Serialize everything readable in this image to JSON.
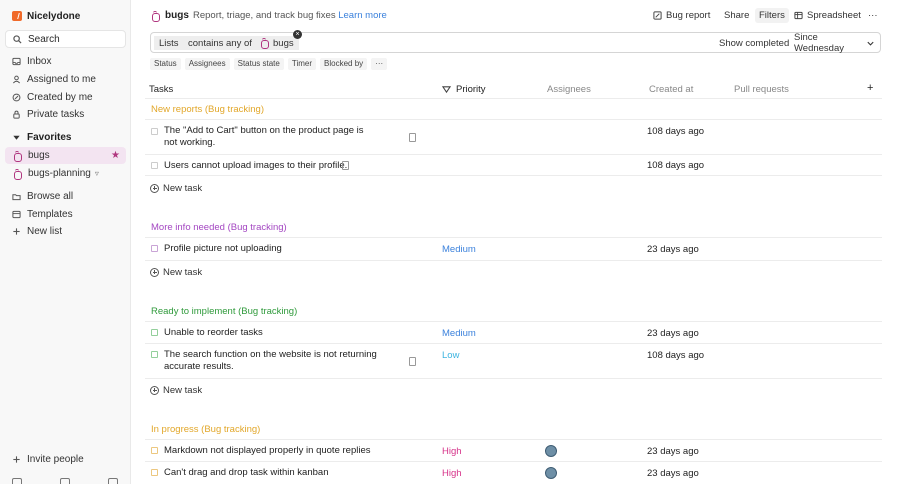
{
  "workspace": {
    "name": "Nicelydone"
  },
  "sidebar": {
    "search_label": "Search",
    "items": [
      {
        "label": "Inbox"
      },
      {
        "label": "Assigned to me"
      },
      {
        "label": "Created by me"
      },
      {
        "label": "Private tasks"
      }
    ],
    "favorites_label": "Favorites",
    "favorites": [
      {
        "label": "bugs"
      },
      {
        "label": "bugs-planning"
      }
    ],
    "more": [
      {
        "label": "Browse all"
      },
      {
        "label": "Templates"
      },
      {
        "label": "New list"
      }
    ],
    "invite_label": "Invite people"
  },
  "topbar": {
    "title": "bugs",
    "description": "Report, triage, and track bug fixes",
    "learn_more": "Learn more",
    "bug_report": "Bug report",
    "share": "Share",
    "filters": "Filters",
    "spreadsheet": "Spreadsheet",
    "more": "···"
  },
  "filter": {
    "field": "Lists",
    "operator": "contains any of",
    "value": "bugs",
    "show_completed": "Show completed",
    "since": "Since Wednesday"
  },
  "column_toggles": [
    "Status",
    "Assignees",
    "Status state",
    "Timer",
    "Blocked by",
    "···"
  ],
  "table": {
    "headers": {
      "tasks": "Tasks",
      "priority": "Priority",
      "assignees": "Assignees",
      "created_at": "Created at",
      "pull_requests": "Pull requests",
      "add": "+"
    }
  },
  "groups": [
    {
      "label": "New reports (Bug tracking)",
      "color": "#e2a72a",
      "rows": [
        {
          "title": "The \"Add to Cart\" button on the product page is not working.",
          "priority": "",
          "created": "108 days ago"
        },
        {
          "title": "Users cannot upload images to their profile.",
          "priority": "",
          "created": "108 days ago"
        }
      ],
      "new_task": "New task"
    },
    {
      "label": "More info needed (Bug tracking)",
      "color": "#a447c2",
      "rows": [
        {
          "title": "Profile picture not uploading",
          "priority": "Medium",
          "created": "23 days ago"
        }
      ],
      "new_task": "New task"
    },
    {
      "label": "Ready to implement (Bug tracking)",
      "color": "#2f9a3b",
      "rows": [
        {
          "title": "Unable to reorder tasks",
          "priority": "Medium",
          "created": "23 days ago"
        },
        {
          "title": "The search function on the website is not returning accurate results.",
          "priority": "Low",
          "created": "108 days ago"
        }
      ],
      "new_task": "New task"
    },
    {
      "label": "In progress (Bug tracking)",
      "color": "#e2a72a",
      "rows": [
        {
          "title": "Markdown not displayed properly in quote replies",
          "priority": "High",
          "created": "23 days ago"
        },
        {
          "title": "Can't drag and drop task within kanban",
          "priority": "High",
          "created": "23 days ago"
        }
      ]
    }
  ],
  "colors": {
    "priority_medium": "#3c82dc",
    "priority_low": "#3cb4e0",
    "priority_high": "#d6338a",
    "accent": "#b0367f"
  }
}
